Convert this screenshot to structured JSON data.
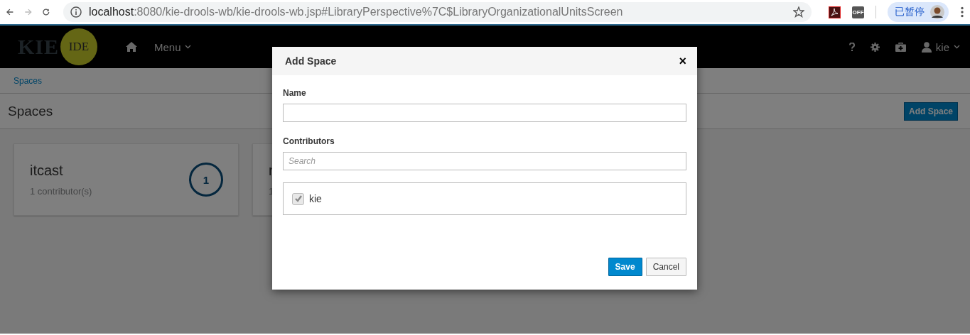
{
  "browser": {
    "url_host": "localhost",
    "url_rest": ":8080/kie-drools-wb/kie-drools-wb.jsp#LibraryPerspective%7C$LibraryOrganizationalUnitsScreen",
    "extension_badge": "OFF",
    "profile_label": "已暂停"
  },
  "navbar": {
    "logo_text": "KIE",
    "logo_badge": "IDE",
    "menu": "Menu",
    "user": "kie"
  },
  "breadcrumb": [
    "Spaces"
  ],
  "page": {
    "title": "Spaces",
    "add_button": "Add Space"
  },
  "spaces": [
    {
      "name": "itcast",
      "contributors": "1 contributor(s)",
      "count": "1"
    },
    {
      "name": "r",
      "contributors": "1"
    }
  ],
  "modal": {
    "title": "Add Space",
    "close": "×",
    "name_label": "Name",
    "contributors_label": "Contributors",
    "search_placeholder": "Search",
    "contributors": [
      {
        "name": "kie",
        "checked": true,
        "disabled": true
      }
    ],
    "buttons": [
      {
        "label": "Save",
        "kind": "primary"
      },
      {
        "label": "Cancel",
        "kind": "default"
      }
    ]
  }
}
